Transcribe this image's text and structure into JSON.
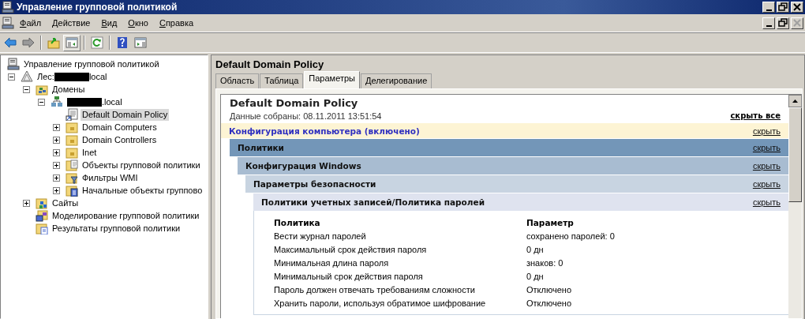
{
  "window": {
    "title": "Управление групповой политикой"
  },
  "menu": [
    "Файл",
    "Действие",
    "Вид",
    "Окно",
    "Справка"
  ],
  "tree": [
    {
      "label": "Управление групповой политикой",
      "kind": "console",
      "selected": false,
      "children": [
        {
          "prefix": "Лес:",
          "redacted": true,
          "label": "local",
          "kind": "forest",
          "expanded": true,
          "selected": false,
          "children": [
            {
              "label": "Домены",
              "kind": "domains",
              "expanded": true,
              "selected": false,
              "children": [
                {
                  "redacted": true,
                  "label": ".local",
                  "kind": "domain",
                  "expanded": true,
                  "selected": false,
                  "children": [
                    {
                      "label": "Default Domain Policy",
                      "kind": "policy",
                      "selected": true
                    },
                    {
                      "label": "Domain Computers",
                      "kind": "ou",
                      "expanded": false,
                      "selected": false
                    },
                    {
                      "label": "Domain Controllers",
                      "kind": "ou",
                      "expanded": false,
                      "selected": false
                    },
                    {
                      "label": "Inet",
                      "kind": "ou",
                      "expanded": false,
                      "selected": false
                    },
                    {
                      "label": "Объекты групповой политики",
                      "kind": "gpo-folder",
                      "expanded": false,
                      "selected": false
                    },
                    {
                      "label": "Фильтры WMI",
                      "kind": "filter-folder",
                      "expanded": false,
                      "selected": false
                    },
                    {
                      "label": "Начальные объекты группово",
                      "kind": "starter-folder",
                      "expanded": false,
                      "selected": false
                    }
                  ]
                }
              ]
            },
            {
              "label": "Сайты",
              "kind": "sites",
              "expanded": false,
              "selected": false
            },
            {
              "label": "Моделирование групповой политики",
              "kind": "modeling",
              "selected": false
            },
            {
              "label": "Результаты групповой политики",
              "kind": "results",
              "selected": false
            }
          ]
        }
      ]
    }
  ],
  "details": {
    "title": "Default Domain Policy",
    "tabs": [
      {
        "label": "Область",
        "selected": false
      },
      {
        "label": "Таблица",
        "selected": false
      },
      {
        "label": "Параметры",
        "selected": true
      },
      {
        "label": "Делегирование",
        "selected": false
      }
    ],
    "report": {
      "title": "Default Domain Policy",
      "collected": "Данные собраны: 08.11.2011 13:51:54",
      "hide_all": "скрыть все",
      "config": {
        "title": "Конфигурация компьютера (включено)",
        "toggle": "скрыть",
        "children": [
          {
            "title": "Политики",
            "toggle": "скрыть",
            "children": [
              {
                "title": "Конфигурация Windows",
                "toggle": "скрыть",
                "children": [
                  {
                    "title": "Параметры безопасности",
                    "toggle": "скрыть",
                    "children": [
                      {
                        "title": "Политики учетных записей/Политика паролей",
                        "toggle": "скрыть",
                        "table": {
                          "columns": [
                            "Политика",
                            "Параметр"
                          ],
                          "rows": [
                            [
                              "Вести журнал паролей",
                              "сохранено паролей: 0"
                            ],
                            [
                              "Максимальный срок действия пароля",
                              "0 дн"
                            ],
                            [
                              "Минимальная длина пароля",
                              "знаков: 0"
                            ],
                            [
                              "Минимальный срок действия пароля",
                              "0 дн"
                            ],
                            [
                              "Пароль должен отвечать требованиям сложности",
                              "Отключено"
                            ],
                            [
                              "Хранить пароли, используя обратимое шифрование",
                              "Отключено"
                            ]
                          ]
                        }
                      }
                    ]
                  }
                ]
              }
            ]
          }
        ]
      }
    }
  }
}
